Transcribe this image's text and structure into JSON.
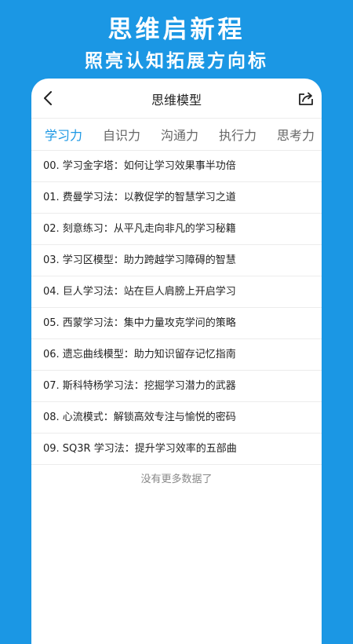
{
  "promo": {
    "title": "思维启新程",
    "subtitle": "照亮认知拓展方向标"
  },
  "nav": {
    "title": "思维模型",
    "back_icon": "chevron-left-icon",
    "share_icon": "share-icon"
  },
  "tabs": [
    {
      "label": "学习力",
      "active": true
    },
    {
      "label": "自识力",
      "active": false
    },
    {
      "label": "沟通力",
      "active": false
    },
    {
      "label": "执行力",
      "active": false
    },
    {
      "label": "思考力",
      "active": false
    }
  ],
  "items": [
    "00. 学习金字塔：如何让学习效果事半功倍",
    "01. 费曼学习法：以教促学的智慧学习之道",
    "02. 刻意练习：从平凡走向非凡的学习秘籍",
    "03. 学习区模型：助力跨越学习障碍的智慧",
    "04. 巨人学习法：站在巨人肩膀上开启学习",
    "05. 西蒙学习法：集中力量攻克学问的策略",
    "06. 遗忘曲线模型：助力知识留存记忆指南",
    "07. 斯科特杨学习法：挖掘学习潜力的武器",
    "08. 心流模式：解锁高效专注与愉悦的密码",
    "09. SQ3R 学习法：提升学习效率的五部曲"
  ],
  "footer": "没有更多数据了",
  "colors": {
    "accent": "#1b97e4",
    "background": "#1b97e4",
    "card": "#ffffff"
  }
}
